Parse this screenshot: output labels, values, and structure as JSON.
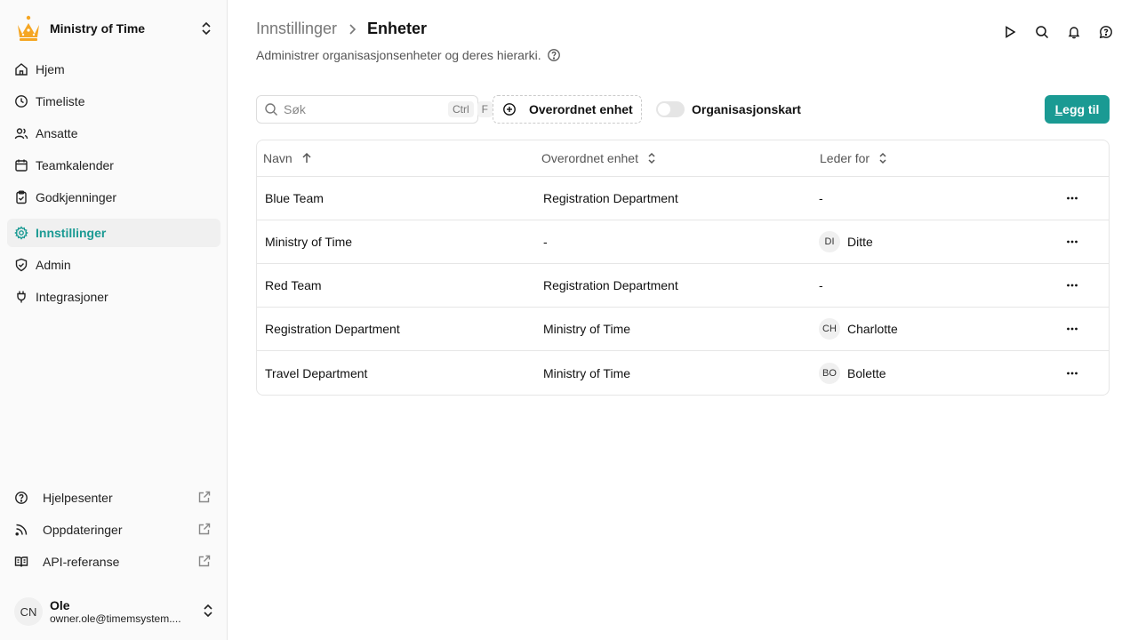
{
  "org": {
    "name": "Ministry of Time"
  },
  "nav": [
    {
      "label": "Hjem",
      "icon": "home-icon",
      "active": false
    },
    {
      "label": "Timeliste",
      "icon": "clock-icon",
      "active": false
    },
    {
      "label": "Ansatte",
      "icon": "users-icon",
      "active": false
    },
    {
      "label": "Teamkalender",
      "icon": "calendar-icon",
      "active": false
    },
    {
      "label": "Godkjenninger",
      "icon": "clipboard-check-icon",
      "active": false
    },
    {
      "label": "Innstillinger",
      "icon": "gear-icon",
      "active": true
    },
    {
      "label": "Admin",
      "icon": "shield-check-icon",
      "active": false
    },
    {
      "label": "Integrasjoner",
      "icon": "plug-icon",
      "active": false
    }
  ],
  "external": [
    {
      "label": "Hjelpesenter",
      "icon": "help-circle-icon"
    },
    {
      "label": "Oppdateringer",
      "icon": "rss-icon"
    },
    {
      "label": "API-referanse",
      "icon": "book-open-icon"
    }
  ],
  "user": {
    "initials": "CN",
    "name": "Ole",
    "email": "owner.ole@timemsystem...."
  },
  "breadcrumb": {
    "parent": "Innstillinger",
    "current": "Enheter"
  },
  "subtitle": "Administrer organisasjonsenheter og deres hierarki.",
  "toolbar": {
    "search_placeholder": "Søk",
    "kbd1": "Ctrl",
    "kbd2": "F",
    "parent_filter": "Overordnet enhet",
    "toggle_label": "Organisasjonskart",
    "toggle_on": false,
    "add_prefix": "L",
    "add_rest": "egg til"
  },
  "table": {
    "headers": {
      "name": "Navn",
      "parent": "Overordnet enhet",
      "leader": "Leder for"
    },
    "rows": [
      {
        "name": "Blue Team",
        "parent": "Registration Department",
        "leader_initials": "",
        "leader": "-"
      },
      {
        "name": "Ministry of Time",
        "parent": "-",
        "leader_initials": "DI",
        "leader": "Ditte"
      },
      {
        "name": "Red Team",
        "parent": "Registration Department",
        "leader_initials": "",
        "leader": "-"
      },
      {
        "name": "Registration Department",
        "parent": "Ministry of Time",
        "leader_initials": "CH",
        "leader": "Charlotte"
      },
      {
        "name": "Travel Department",
        "parent": "Ministry of Time",
        "leader_initials": "BO",
        "leader": "Bolette"
      }
    ]
  },
  "colors": {
    "accent": "#1a9a93",
    "crown": "#f5a623"
  }
}
